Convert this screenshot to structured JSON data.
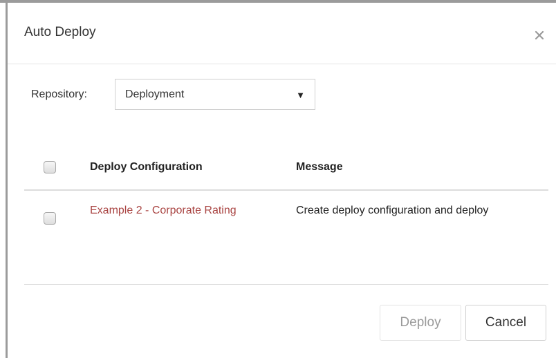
{
  "dialog": {
    "title": "Auto Deploy",
    "close_icon": "close-icon"
  },
  "repository": {
    "label": "Repository:",
    "selected": "Deployment",
    "caret": "▼"
  },
  "table": {
    "columns": [
      "Deploy Configuration",
      "Message"
    ],
    "rows": [
      {
        "configuration": "Example 2 - Corporate Rating",
        "message": "Create deploy configuration and deploy",
        "checked": false
      }
    ]
  },
  "buttons": {
    "deploy": "Deploy",
    "cancel": "Cancel"
  },
  "colors": {
    "link": "#a94442",
    "disabled_text": "#9a9a9a"
  }
}
